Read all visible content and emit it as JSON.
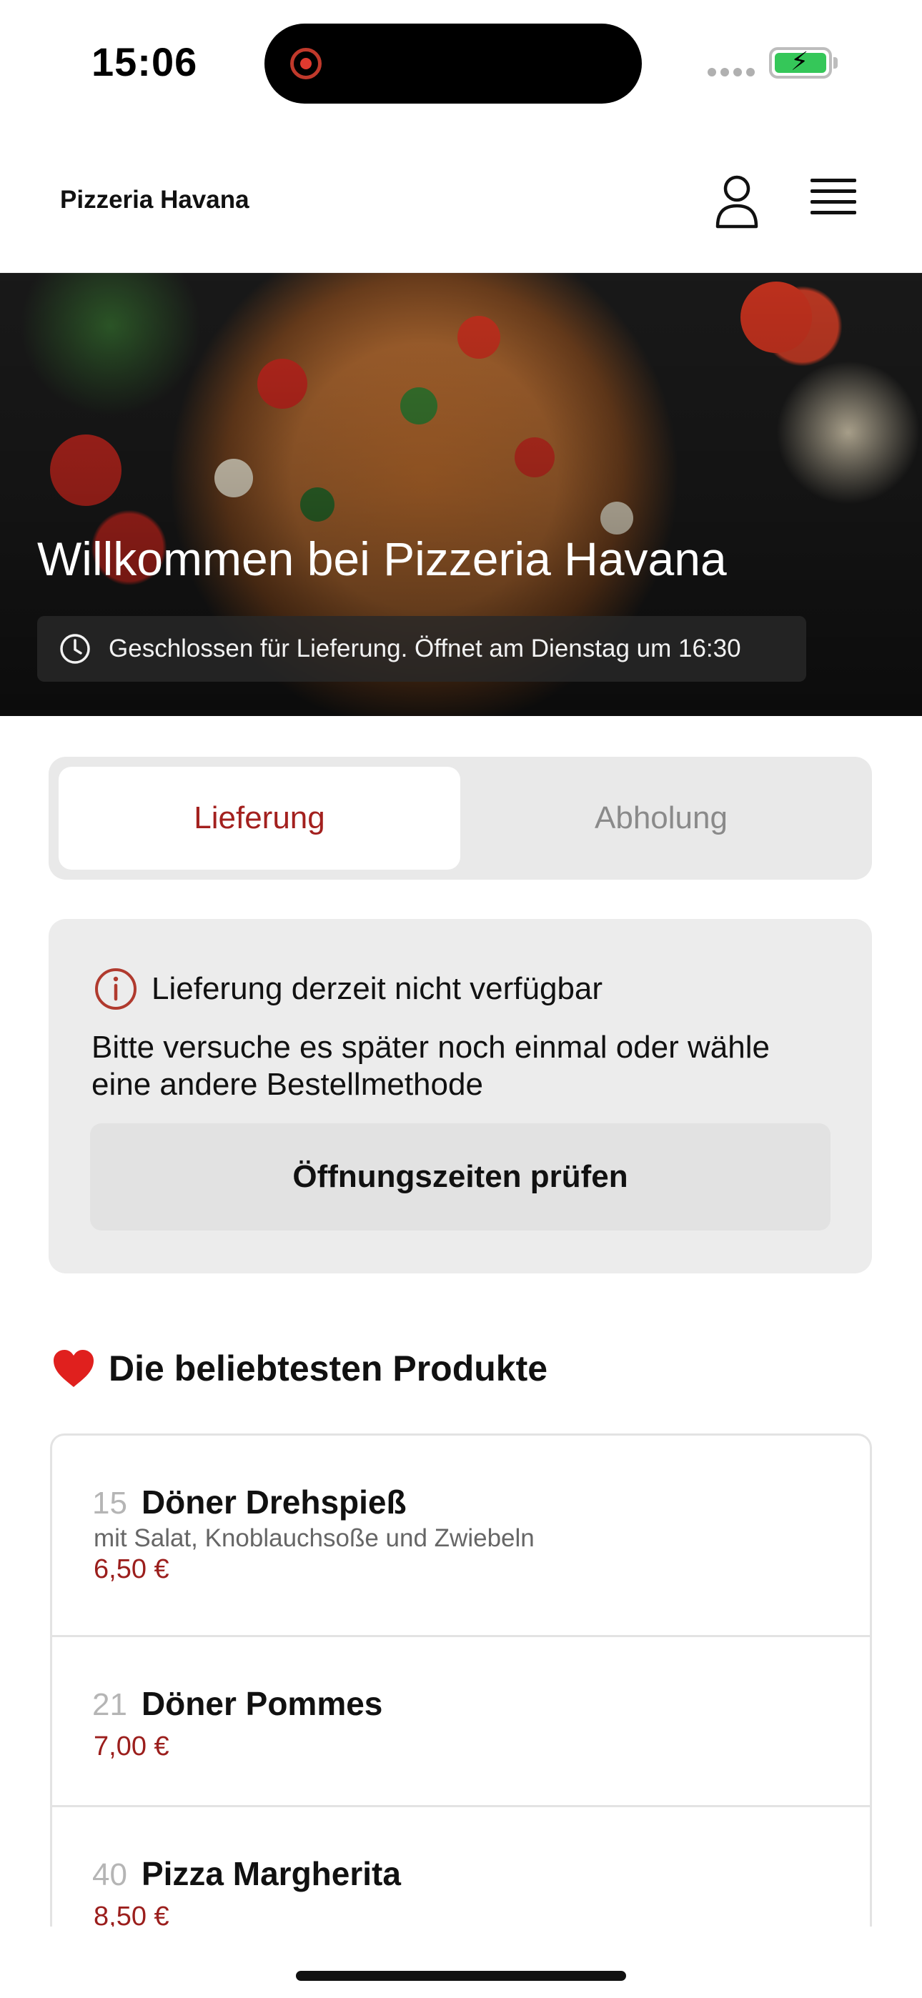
{
  "status_bar": {
    "time": "15:06"
  },
  "header": {
    "brand": "Pizzeria Havana"
  },
  "hero": {
    "title": "Willkommen bei Pizzeria Havana",
    "notice": "Geschlossen für Lieferung. Öffnet am Dienstag um 16:30"
  },
  "order_mode": {
    "options": [
      "Lieferung",
      "Abholung"
    ],
    "selected": "Lieferung"
  },
  "info_card": {
    "title": "Lieferung derzeit nicht verfügbar",
    "text": "Bitte versuche es später noch einmal oder wähle eine andere Bestellmethode",
    "button": "Öffnungszeiten prüfen"
  },
  "popular": {
    "title": "Die beliebtesten Produkte",
    "items": [
      {
        "number": "15",
        "name": "Döner Drehspieß",
        "description": "mit Salat, Knoblauchsoße und Zwiebeln",
        "price": "6,50 €"
      },
      {
        "number": "21",
        "name": "Döner Pommes",
        "price": "7,00 €"
      },
      {
        "number": "40",
        "name": "Pizza Margherita",
        "price": "8,50 €"
      }
    ]
  },
  "colors": {
    "accent": "#a3201e",
    "price": "#9b1e1c",
    "battery": "#35c759"
  },
  "icons": [
    "record-icon",
    "signal-icon",
    "battery-icon",
    "user-icon",
    "menu-icon",
    "clock-icon",
    "info-icon",
    "heart-icon"
  ]
}
